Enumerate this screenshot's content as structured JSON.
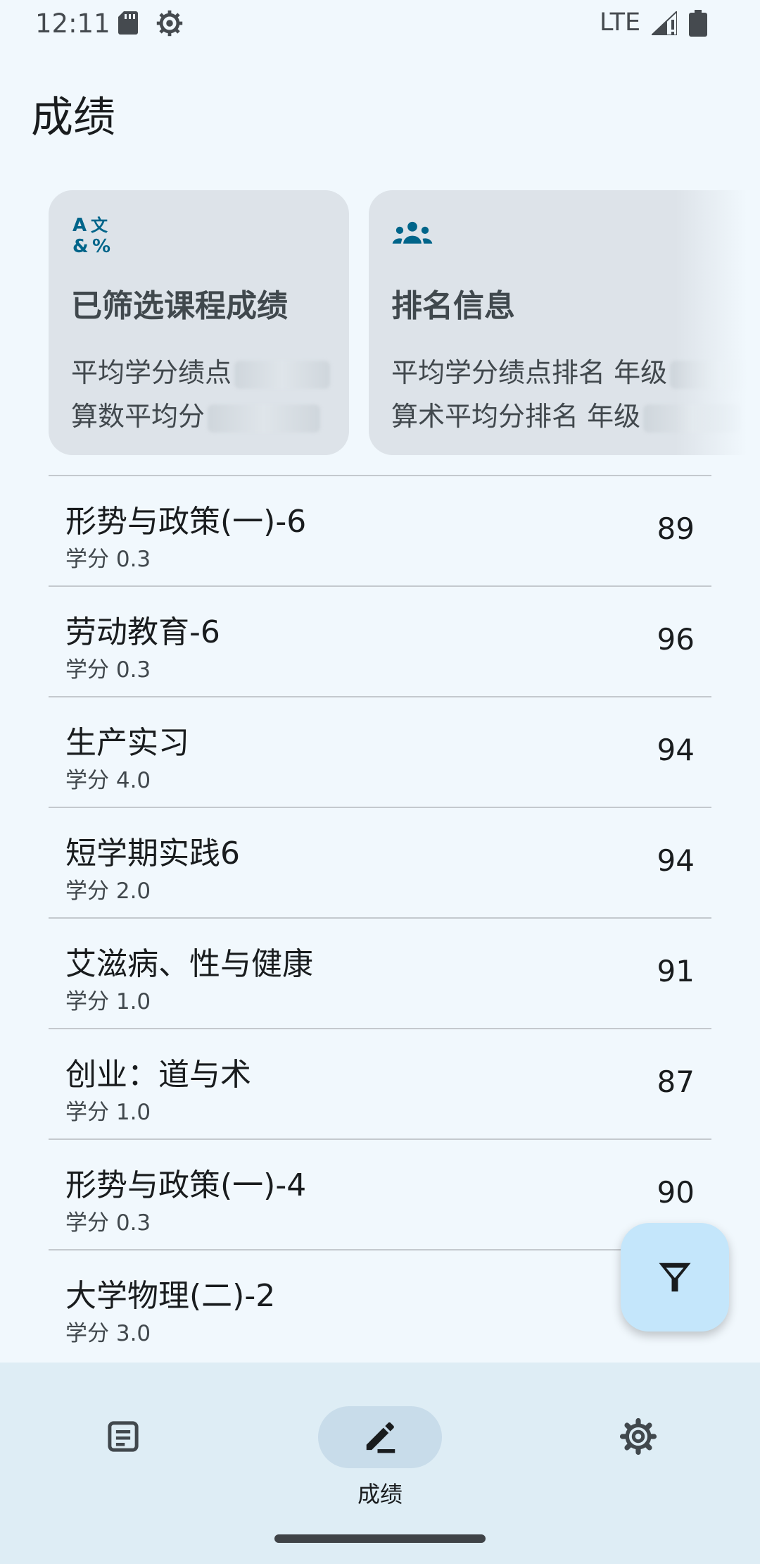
{
  "status_bar": {
    "time": "12:11",
    "network": "LTE",
    "icons": [
      "sd-card-icon",
      "settings-gear-icon",
      "signal-icon",
      "battery-icon"
    ]
  },
  "page": {
    "title": "成绩"
  },
  "cards": [
    {
      "icon": "translate-icon",
      "title": "已筛选课程成绩",
      "line1_label": "平均学分绩点",
      "line2_label": "算数平均分"
    },
    {
      "icon": "groups-icon",
      "title": "排名信息",
      "line1_label": "平均学分绩点排名 年级",
      "line2_label": "算术平均分排名 年级"
    }
  ],
  "grades": [
    {
      "name": "形势与政策(一)-6",
      "credit": "学分 0.3",
      "score": "89"
    },
    {
      "name": "劳动教育-6",
      "credit": "学分 0.3",
      "score": "96"
    },
    {
      "name": "生产实习",
      "credit": "学分 4.0",
      "score": "94"
    },
    {
      "name": "短学期实践6",
      "credit": "学分 2.0",
      "score": "94"
    },
    {
      "name": "艾滋病、性与健康",
      "credit": "学分 1.0",
      "score": "91"
    },
    {
      "name": "创业：道与术",
      "credit": "学分 1.0",
      "score": "87"
    },
    {
      "name": "形势与政策(一)-4",
      "credit": "学分 0.3",
      "score": "90"
    },
    {
      "name": "大学物理(二)-2",
      "credit": "学分 3.0",
      "score": ""
    }
  ],
  "fab": {
    "icon": "filter-icon"
  },
  "bottom_nav": {
    "items": [
      {
        "icon": "document-icon",
        "label": ""
      },
      {
        "icon": "edit-icon",
        "label": "成绩",
        "active": true
      },
      {
        "icon": "settings-icon",
        "label": ""
      }
    ]
  },
  "colors": {
    "background": "#f1f8fd",
    "card": "#dde3e9",
    "accent": "#00658a",
    "fab": "#c4e6fb",
    "nav_background": "#deedf5"
  }
}
